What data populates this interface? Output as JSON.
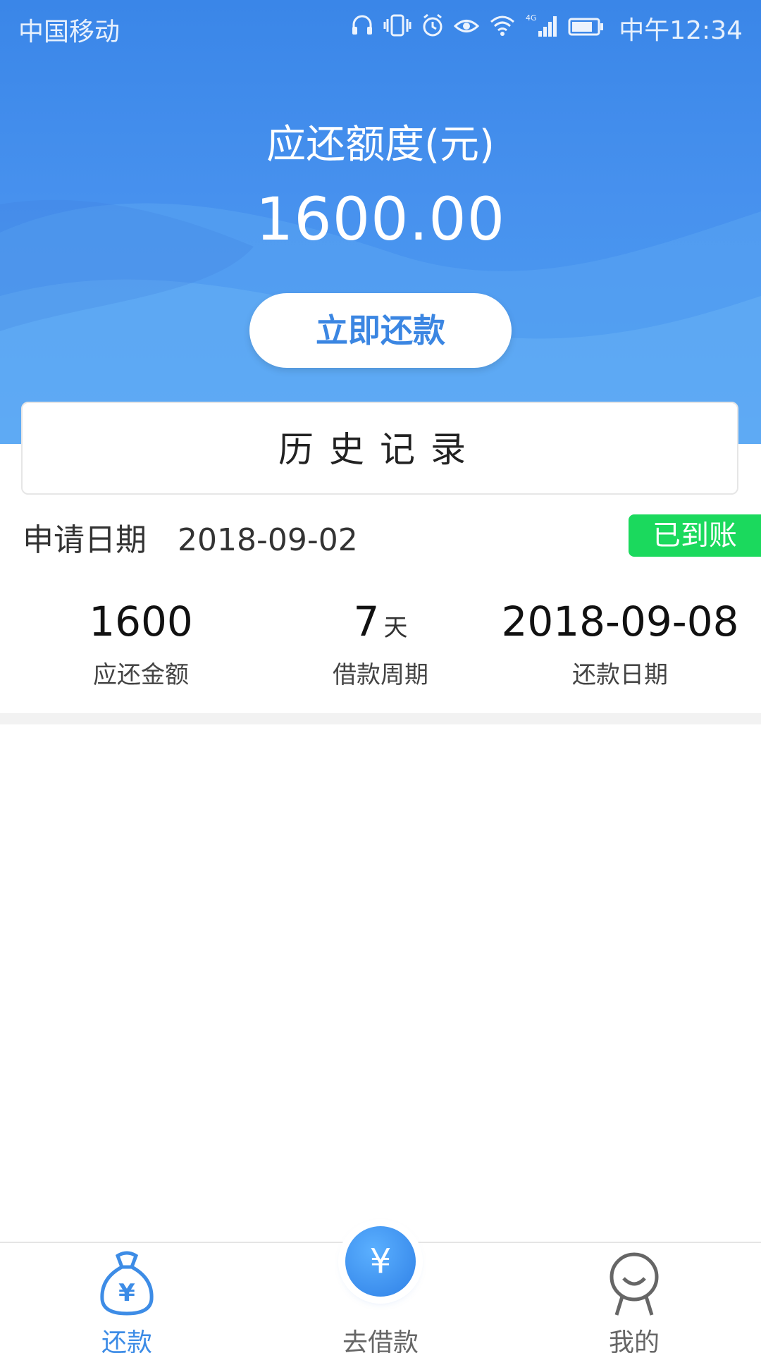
{
  "status_bar": {
    "carrier": "中国移动",
    "time": "中午12:34",
    "network": "4G"
  },
  "summary": {
    "amount_label": "应还额度(元)",
    "amount_value": "1600.00",
    "repay_button_label": "立即还款"
  },
  "history": {
    "title": "历史记录"
  },
  "record": {
    "date_label": "申请日期",
    "date_value": "2018-09-02",
    "status": "已到账",
    "stats": [
      {
        "value": "1600",
        "unit": "",
        "label": "应还金额"
      },
      {
        "value": "7",
        "unit": "天",
        "label": "借款周期"
      },
      {
        "value": "2018-09-08",
        "unit": "",
        "label": "还款日期"
      }
    ]
  },
  "bottom_nav": {
    "items": [
      {
        "label": "还款",
        "icon": "money-bag-icon",
        "active": true
      },
      {
        "label": "去借款",
        "icon": "yen-icon",
        "active": false
      },
      {
        "label": "我的",
        "icon": "profile-icon",
        "active": false
      }
    ],
    "fab_symbol": "¥",
    "bag_symbol": "¥"
  },
  "colors": {
    "primary": "#3b86e2",
    "status_green": "#1bd95d"
  }
}
